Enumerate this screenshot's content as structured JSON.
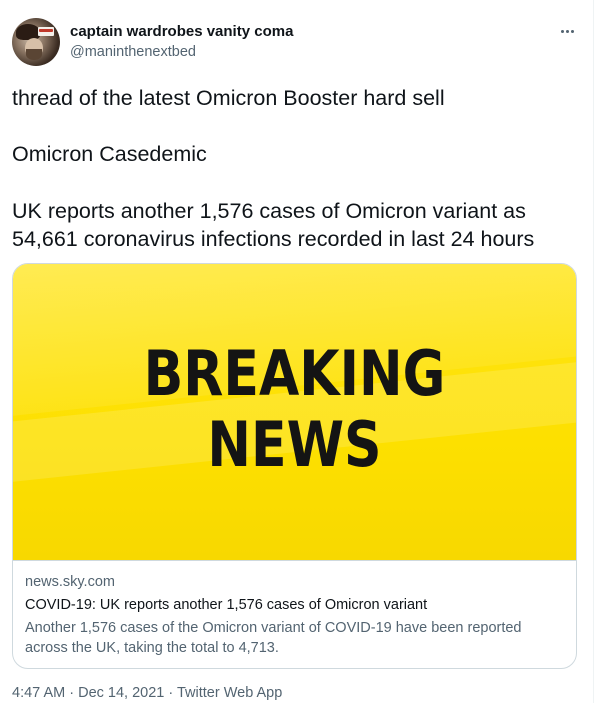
{
  "user": {
    "display_name": "captain wardrobes vanity coma",
    "handle": "@maninthenextbed"
  },
  "tweet": {
    "line1": "thread of the latest Omicron Booster hard sell",
    "line2": "Omicron Casedemic",
    "line3": "UK reports another 1,576 cases of Omicron variant as",
    "line4": "54,661 coronavirus infections recorded in last 24 hours"
  },
  "card": {
    "image_line1": "BREAKING",
    "image_line2": "NEWS",
    "domain": "news.sky.com",
    "title": "COVID-19: UK reports another 1,576 cases of Omicron variant",
    "description": "Another 1,576 cases of the Omicron variant of COVID-19 have been reported across the UK, taking the total to 4,713."
  },
  "meta": {
    "time": "4:47 AM",
    "date": "Dec 14, 2021",
    "source": "Twitter Web App",
    "separator": " · "
  },
  "colors": {
    "text": "#0f1419",
    "secondary": "#536471",
    "border": "#cfd9de",
    "breaking_yellow": "#fde000"
  }
}
